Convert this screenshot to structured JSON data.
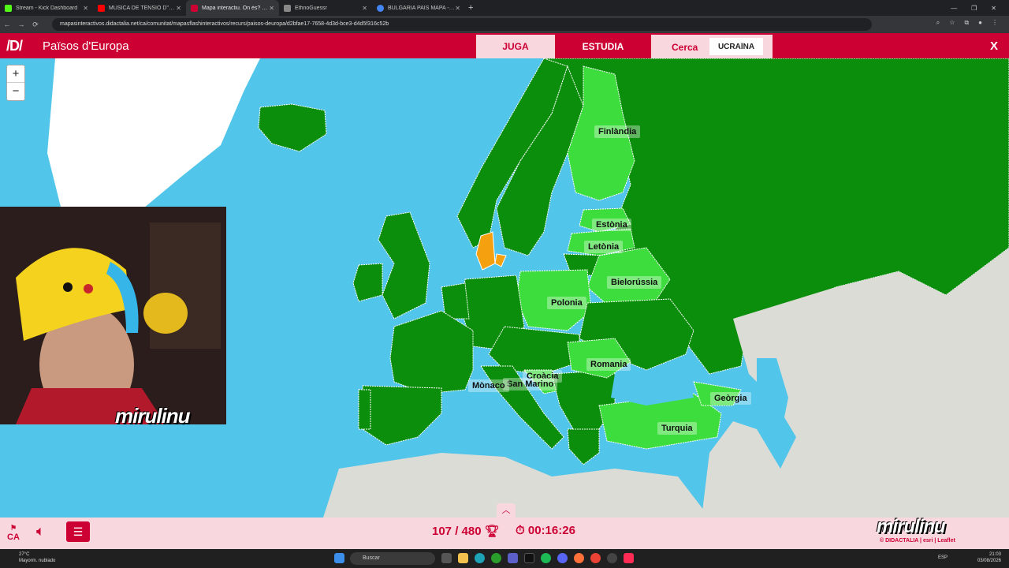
{
  "browser": {
    "tabs": [
      {
        "label": "Stream - Kick Dashboard",
        "color": "#53fc18"
      },
      {
        "label": "MÚSICA DE TENSIÓ D''EL...",
        "color": "#ff0000"
      },
      {
        "label": "Mapa interactiu. On és? Països",
        "color": "#cc0033",
        "active": true
      },
      {
        "label": "EthnoGuessr",
        "color": "#888888"
      },
      {
        "label": "BULGARIA PAIS MAPA - Cerca...",
        "color": "#4285f4"
      }
    ],
    "url": "mapasinteractivos.didactalia.net/ca/comunitat/mapasflashinteractivos/recurs/paisos-deuropa/d2bfae17-7658-4d3d-bce3-d4d5f316c52b"
  },
  "header": {
    "logo": "/D/",
    "title": "Països d'Europa",
    "play_label": "JUGA",
    "study_label": "ESTUDIA",
    "search_label": "Cerca",
    "search_value": "UCRAÏNA",
    "close_label": "X"
  },
  "map": {
    "zoom_in": "+",
    "zoom_out": "−",
    "colors": {
      "sea": "#51c5ea",
      "land_out": "#dcdcd6",
      "country": "#0b8e0b",
      "highlight": "#3ddd3d",
      "selected": "#f5a00f",
      "greenland": "#ffffff"
    },
    "labels": [
      "Finlàndia",
      "Estònia",
      "Letònia",
      "Bielorússia",
      "Polonia",
      "Romania",
      "Croàcia",
      "San Marino",
      "Mònaco",
      "Geòrgia",
      "Turquia"
    ]
  },
  "webcam": {
    "overlay_name": "mirulinu"
  },
  "bottom": {
    "lang": "CA",
    "score": "107 / 480",
    "timer": "00:16:26",
    "brand": "mirulinu",
    "credits": "© DIDACTALIA | esri | Leaflet"
  },
  "taskbar": {
    "weather_temp": "27°C",
    "weather_desc": "Mayorm. nublado",
    "search": "Buscar",
    "lang": "ESP",
    "time": "21:03",
    "date": "03/08/2026"
  }
}
